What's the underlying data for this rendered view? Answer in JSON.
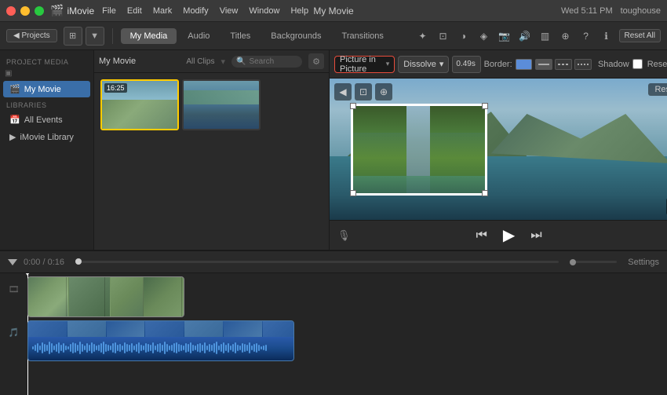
{
  "app": {
    "name": "iMovie",
    "title": "My Movie",
    "username": "toughouse"
  },
  "titlebar": {
    "menus": [
      "iMovie",
      "File",
      "Edit",
      "Mark",
      "Modify",
      "View",
      "Window",
      "Help"
    ],
    "time": "Wed 5:11 PM",
    "back_button": "◀ Projects"
  },
  "toolbar": {
    "tabs": [
      {
        "label": "My Media",
        "active": true
      },
      {
        "label": "Audio",
        "active": false
      },
      {
        "label": "Titles",
        "active": false
      },
      {
        "label": "Backgrounds",
        "active": false
      },
      {
        "label": "Transitions",
        "active": false
      }
    ]
  },
  "sidebar": {
    "sections": [
      {
        "header": "PROJECT MEDIA",
        "items": [
          {
            "label": "My Movie",
            "active": true,
            "icon": "🎬"
          }
        ]
      },
      {
        "header": "LIBRARIES",
        "items": [
          {
            "label": "All Events",
            "active": false,
            "icon": "📅"
          },
          {
            "label": "iMovie Library",
            "active": false,
            "icon": "▶"
          }
        ]
      }
    ]
  },
  "media_browser": {
    "title": "My Movie",
    "clips_label": "All Clips",
    "search_placeholder": "Search",
    "clips": [
      {
        "duration": "16:25",
        "index": 0
      },
      {
        "duration": "",
        "index": 1
      }
    ]
  },
  "canvas": {
    "pip_label": "Picture in Picture",
    "transition_label": "Dissolve",
    "duration": "0.49s",
    "border_label": "Border:",
    "shadow_label": "Shadow",
    "reset_label": "Reset",
    "canvas_reset_label": "Reset",
    "nav": {
      "back": "◀",
      "zoom_fit": "⊡",
      "zoom_in": "+"
    }
  },
  "playback": {
    "skip_back": "⏮",
    "play": "▶",
    "skip_forward": "⏭"
  },
  "timeline": {
    "current_time": "0:00",
    "total_time": "0:16",
    "settings_label": "Settings"
  }
}
